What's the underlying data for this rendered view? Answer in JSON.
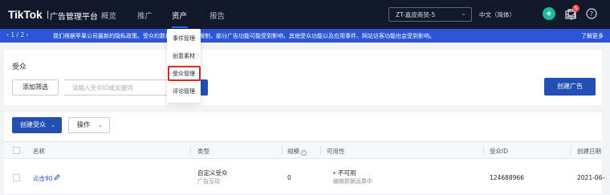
{
  "topnav": {
    "logo": "TikTok",
    "logo_sub": "广告管理平台",
    "items": [
      {
        "label": "概览",
        "active": false
      },
      {
        "label": "推广",
        "active": false
      },
      {
        "label": "资产",
        "active": true
      },
      {
        "label": "报告",
        "active": false
      }
    ],
    "account": "ZT-嘉皮商贸-5",
    "language": "中文（简体）",
    "avatar_letter": "e",
    "notification_count": "5",
    "icons": [
      "briefcase-icon",
      "bell-icon",
      "help-icon"
    ]
  },
  "notice": {
    "pager": "‹  1 / 2  ›",
    "message": "我们根据苹果公司最新的隐私政策。受众的数据来源会受到限制，部分广告功能可能受到影响，其他受众功能以及应用事件、网站访客功能也会受到影响。",
    "more": "了解更多"
  },
  "dropdown": {
    "items": [
      "事件管理",
      "创意素材",
      "受众管理",
      "评论管理"
    ],
    "selected_index": 2
  },
  "filter": {
    "title": "受众",
    "add_filter": "添加筛选",
    "search_placeholder": "请输入受众ID或关键词",
    "create_ad": "创建广告"
  },
  "table": {
    "create_audience": "创建受众",
    "operations": "操作",
    "columns": [
      "名称",
      "类型",
      "规模",
      "可用性",
      "受众ID",
      "创建日期"
    ],
    "rows": [
      {
        "name": "点击90",
        "type": "自定义受众",
        "type_sub": "广告互动",
        "size": "0",
        "availability": "不可用",
        "availability_sub": "编辑数据运算中",
        "audience_id": "124688966",
        "created": "2021-06-"
      }
    ]
  },
  "colors": {
    "nav_bg": "#10182a",
    "notice_bg": "#2c55d6",
    "primary": "#234fb2",
    "highlight": "#e0261e"
  }
}
